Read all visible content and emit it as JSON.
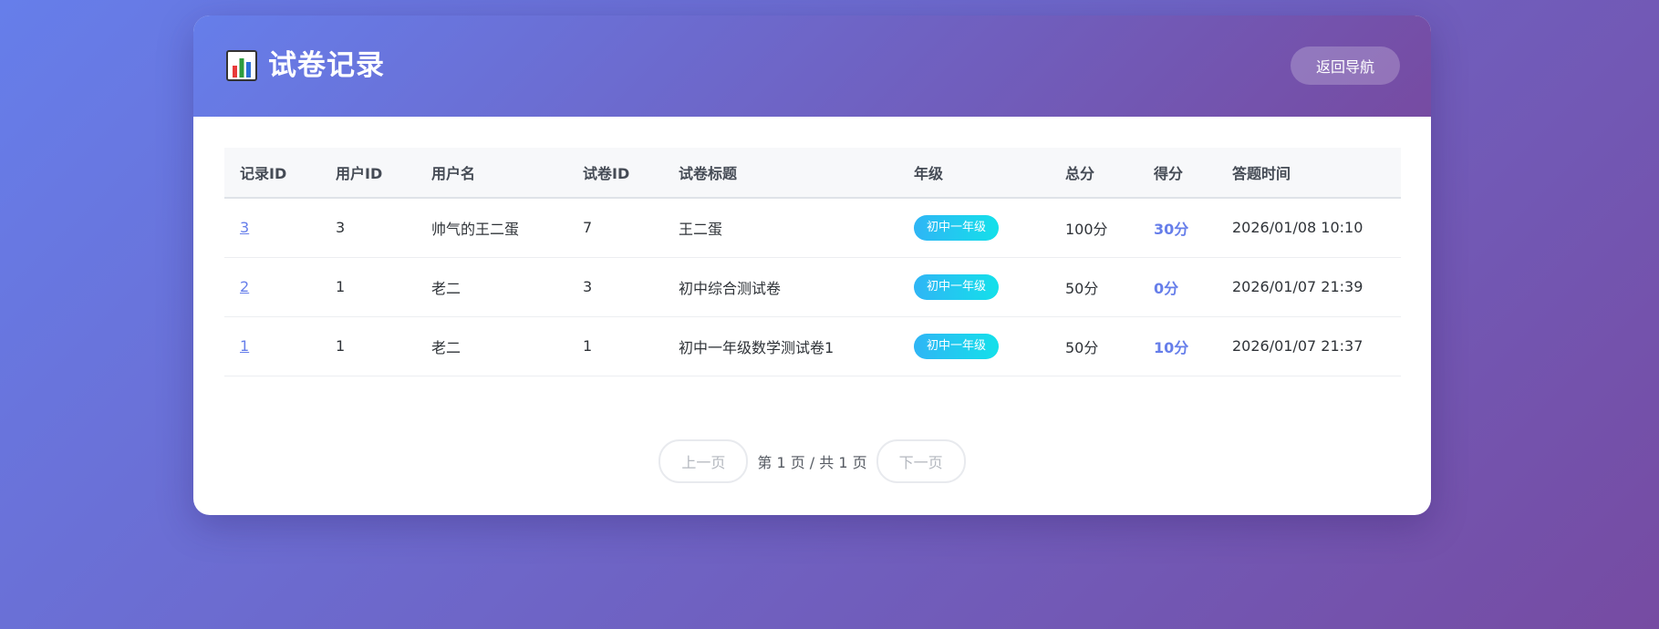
{
  "header": {
    "title": "试卷记录",
    "back_label": "返回导航",
    "icon": "bar-chart-icon"
  },
  "table": {
    "columns": [
      "记录ID",
      "用户ID",
      "用户名",
      "试卷ID",
      "试卷标题",
      "年级",
      "总分",
      "得分",
      "答题时间"
    ],
    "rows": [
      {
        "record_id": "3",
        "user_id": "3",
        "username": "帅气的王二蛋",
        "paper_id": "7",
        "paper_title": "王二蛋",
        "grade": "初中一年级",
        "total": "100分",
        "score": "30分",
        "time": "2026/01/08 10:10"
      },
      {
        "record_id": "2",
        "user_id": "1",
        "username": "老二",
        "paper_id": "3",
        "paper_title": "初中综合测试卷",
        "grade": "初中一年级",
        "total": "50分",
        "score": "0分",
        "time": "2026/01/07 21:39"
      },
      {
        "record_id": "1",
        "user_id": "1",
        "username": "老二",
        "paper_id": "1",
        "paper_title": "初中一年级数学测试卷1",
        "grade": "初中一年级",
        "total": "50分",
        "score": "10分",
        "time": "2026/01/07 21:37"
      }
    ]
  },
  "pagination": {
    "prev_label": "上一页",
    "info": "第 1 页 / 共 1 页",
    "next_label": "下一页"
  },
  "colors": {
    "gradient_start": "#667eea",
    "gradient_end": "#764ba2",
    "badge_start": "#2fb5f5",
    "badge_end": "#14e0ea"
  }
}
